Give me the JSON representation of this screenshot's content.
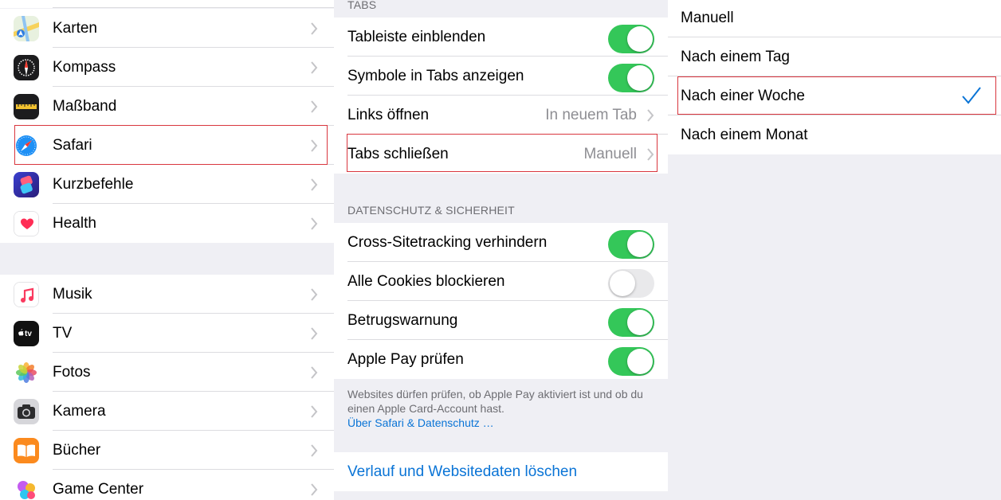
{
  "settings_list": {
    "group1": [
      {
        "label": "Karten",
        "icon": "maps-icon"
      },
      {
        "label": "Kompass",
        "icon": "compass-icon"
      },
      {
        "label": "Maßband",
        "icon": "measure-icon"
      },
      {
        "label": "Safari",
        "icon": "safari-icon",
        "highlighted": true
      },
      {
        "label": "Kurzbefehle",
        "icon": "shortcuts-icon"
      },
      {
        "label": "Health",
        "icon": "health-icon"
      }
    ],
    "group2": [
      {
        "label": "Musik",
        "icon": "music-icon"
      },
      {
        "label": "TV",
        "icon": "tv-icon",
        "icon_text": "tv"
      },
      {
        "label": "Fotos",
        "icon": "photos-icon"
      },
      {
        "label": "Kamera",
        "icon": "camera-icon"
      },
      {
        "label": "Bücher",
        "icon": "books-icon"
      },
      {
        "label": "Game Center",
        "icon": "game-center-icon"
      }
    ]
  },
  "safari_settings": {
    "tabs_header": "TABS",
    "tabs": [
      {
        "label": "Tableiste einblenden",
        "toggle": true
      },
      {
        "label": "Symbole in Tabs anzeigen",
        "toggle": true
      },
      {
        "label": "Links öffnen",
        "value": "In neuem Tab"
      },
      {
        "label": "Tabs schließen",
        "value": "Manuell",
        "highlighted": true
      }
    ],
    "privacy_header": "DATENSCHUTZ & SICHERHEIT",
    "privacy": [
      {
        "label": "Cross-Sitetracking verhindern",
        "toggle": true
      },
      {
        "label": "Alle Cookies blockieren",
        "toggle": false
      },
      {
        "label": "Betrugswarnung",
        "toggle": true
      },
      {
        "label": "Apple Pay prüfen",
        "toggle": true
      }
    ],
    "footnote": "Websites dürfen prüfen, ob Apple Pay aktiviert ist und ob du einen Apple Card-Account hast.",
    "footnote_link": "Über Safari & Datenschutz …",
    "clear_history": "Verlauf und Websitedaten löschen"
  },
  "close_tabs_options": {
    "options": [
      {
        "label": "Manuell",
        "selected": false
      },
      {
        "label": "Nach einem Tag",
        "selected": false
      },
      {
        "label": "Nach einer Woche",
        "selected": true
      },
      {
        "label": "Nach einem Monat",
        "selected": false
      }
    ]
  },
  "colors": {
    "toggle_on": "#34c759",
    "link_blue": "#0a74d6",
    "highlight_red": "#d9363e"
  }
}
